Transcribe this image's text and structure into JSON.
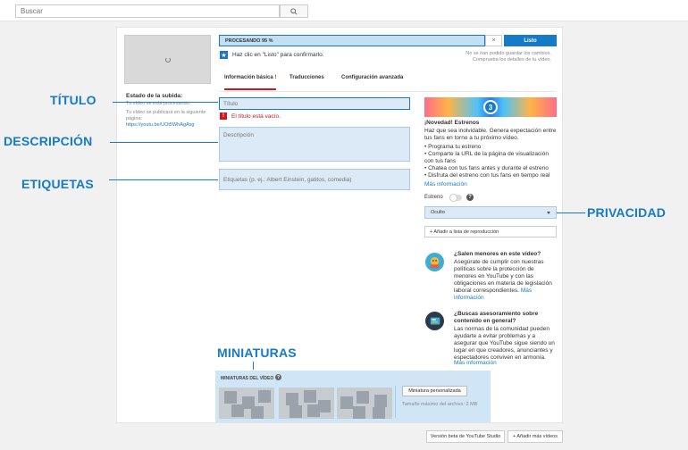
{
  "search": {
    "placeholder": "Buscar"
  },
  "upload": {
    "progress_text": "PROCESANDO 95 %",
    "progress_percent": 95,
    "cancel_label": "×",
    "done_label": "Listo",
    "hint": "Haz clic en \"Listo\" para confirmarlo.",
    "save_note_1": "No se han podido guardar los cambios.",
    "save_note_2": "Comprueba los detalles de tu vídeo."
  },
  "status": {
    "title": "Estado de la subida:",
    "processing": "Tu vídeo se está procesando.",
    "published_1": "Tu vídeo se publicará en la siguiente",
    "published_2": "página:",
    "link": "https://youtu.be/UOt5WhAgAsg"
  },
  "tabs": [
    {
      "label": "Información básica",
      "warn": "!"
    },
    {
      "label": "Traducciones"
    },
    {
      "label": "Configuración avanzada"
    }
  ],
  "form": {
    "title_placeholder": "Título",
    "title_error": "El título está vacío.",
    "desc_placeholder": "Descripción",
    "tags_placeholder": "Etiquetas (p. ej.: Albert Einstein, gatitos, comedia)"
  },
  "promo": {
    "badge": "3",
    "title": "¡Novedad! Estrenos",
    "body": "Haz que sea inolvidable. Genera expectación entre tus fans en torno a tu próximo vídeo.",
    "items": [
      "• Programa tu estreno",
      "• Comparte la URL de la página de visualización con tus fans",
      "• Chatea con tus fans antes y durante el estreno",
      "• Disfruta del estreno con tus fans en tiempo real"
    ],
    "more": "Más información"
  },
  "premiere": {
    "label": "Estreno",
    "enabled": false
  },
  "privacy": {
    "selected": "Oculto"
  },
  "playlist": {
    "label": "+ Añadir a lista de reproducción"
  },
  "info1": {
    "title": "¿Salen menores en este vídeo?",
    "body": "Asegúrate de cumplir con nuestras políticas sobre la protección de menores en YouTube y con las obligaciones en materia de legislación laboral correspondientes.",
    "more": "Más información"
  },
  "info2": {
    "title": "¿Buscas asesoramiento sobre contenido en general?",
    "body": "Las normas de la comunidad pueden ayudarte a evitar problemas y a asegurar que YouTube sigue siendo un lugar en que creadores, anunciantes y espectadores conviven en armonía.",
    "more": "Más información"
  },
  "thumbnails": {
    "label": "MINIATURAS DEL VÍDEO",
    "custom_label": "Miniatura personalizada",
    "max_size": "Tamaño máximo del archivo: 2 MB"
  },
  "footer": {
    "studio_beta": "Versión beta de YouTube Studio",
    "add_more": "+ Añadir más vídeos"
  },
  "callouts": {
    "title": "TÍTULO",
    "description": "DESCRIPCIÓN",
    "tags": "ETIQUETAS",
    "privacy": "PRIVACIDAD",
    "thumbnails": "MINIATURAS"
  },
  "colors": {
    "accent": "#167ac6",
    "error": "#cc181e",
    "field_bg": "#dbeaf6"
  }
}
